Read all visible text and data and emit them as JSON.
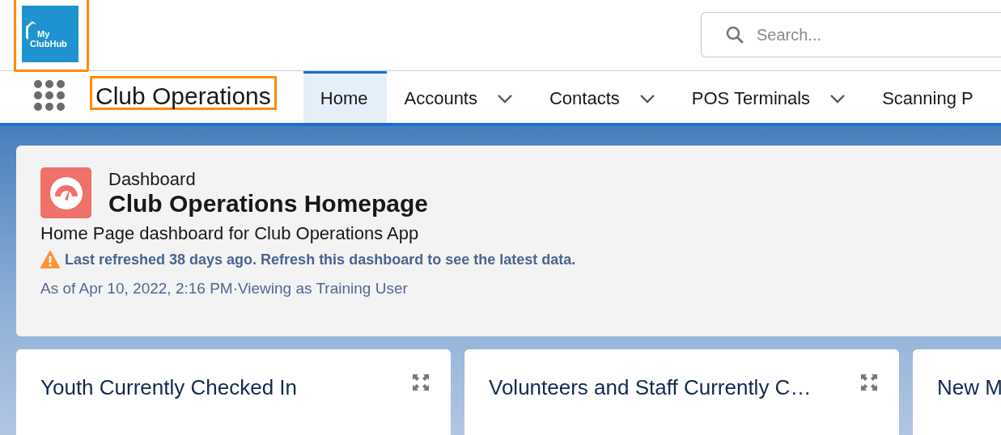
{
  "header": {
    "logo": {
      "line_1": "My",
      "line_2": "ClubHub",
      "highlighted": true
    },
    "search": {
      "placeholder": "Search..."
    }
  },
  "nav": {
    "app_name": "Club Operations",
    "app_name_highlighted": true,
    "tabs": [
      {
        "label": "Home",
        "selected": true,
        "menu": false
      },
      {
        "label": "Accounts",
        "selected": false,
        "menu": true
      },
      {
        "label": "Contacts",
        "selected": false,
        "menu": true
      },
      {
        "label": "POS Terminals",
        "selected": false,
        "menu": true
      },
      {
        "label": "Scanning P",
        "selected": false,
        "menu": false
      }
    ]
  },
  "dashboard": {
    "type_label": "Dashboard",
    "title": "Club Operations Homepage",
    "description": "Home Page dashboard for Club Operations App",
    "warning": "Last refreshed 38 days ago. Refresh this dashboard to see the latest data.",
    "meta": "As of Apr 10, 2022, 2:16 PM·Viewing as Training User"
  },
  "cards": [
    {
      "title": "Youth Currently Checked In",
      "expandable": true
    },
    {
      "title": "Volunteers and Staff Currently C…",
      "expandable": true
    },
    {
      "title": "New M",
      "expandable": false
    }
  ]
}
